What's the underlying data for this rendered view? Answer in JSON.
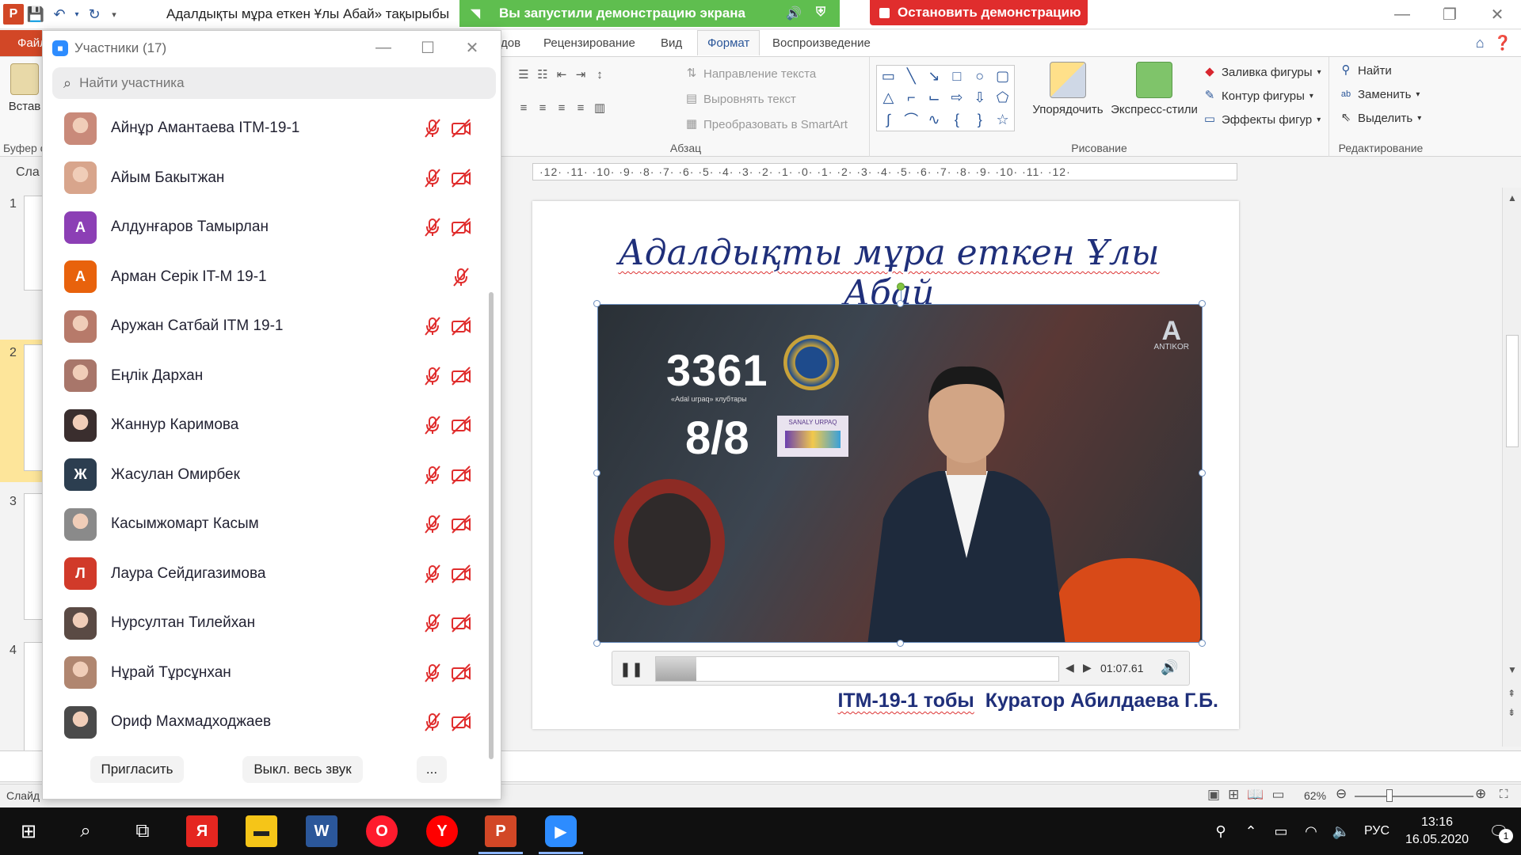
{
  "app": {
    "doc_title": "Адалдықты мұра еткен Ұлы Абай» тақырыбы",
    "logo_letter": "P"
  },
  "share_banner": {
    "message": "Вы запустили демонстрацию экрана",
    "stop_label": "Остановить демонстрацию"
  },
  "ribbon_tabs": {
    "file": "Файл",
    "items": [
      "дов",
      "Рецензирование",
      "Вид",
      "Формат",
      "Воспроизведение"
    ],
    "active": "Формат"
  },
  "ribbon": {
    "paste_label": "Встав",
    "clipboard_label": "Буфер о",
    "text_direction": "Направление текста",
    "align_text": "Выровнять текст",
    "smartart": "Преобразовать в SmartArt",
    "paragraph_label": "Абзац",
    "arrange": "Упорядочить",
    "quick_styles": "Экспресс-стили",
    "shape_fill": "Заливка фигуры",
    "shape_outline": "Контур фигуры",
    "shape_effects": "Эффекты фигур",
    "drawing_label": "Рисование",
    "find": "Найти",
    "replace": "Заменить",
    "select": "Выделить",
    "editing_label": "Редактирование",
    "accent_color": "#d24726"
  },
  "thumbs": {
    "header": "Сла",
    "numbers": [
      "1",
      "2",
      "3",
      "4"
    ]
  },
  "ruler": {
    "text": "·12·  ·11·  ·10·  ·9·  ·8·  ·7·  ·6·  ·5·  ·4·  ·3·  ·2·  ·1·  ·0·  ·1·  ·2·  ·3·  ·4·  ·5·  ·6·  ·7·  ·8·  ·9·  ·10·  ·11·  ·12·"
  },
  "slide": {
    "title": "Адалдықты мұра еткен Ұлы Абай",
    "video": {
      "overlay_number": "3361",
      "overlay_caption": "«Adal urpaq» клубтары",
      "overlay_score": "8/8",
      "brand": "ANTIKOR",
      "brand_letter": "A",
      "card_text": "SANALY URPAQ"
    },
    "player": {
      "time": "01:07.61",
      "progress": 0.1
    },
    "footer_group": "ITM-19-1 тобы",
    "footer_curator": "Куратор Абилдаева Г.Б."
  },
  "statusbar": {
    "slide_label": "Слайд",
    "zoom": "62%"
  },
  "participants": {
    "title": "Участники (17)",
    "search_placeholder": "Найти участника",
    "list": [
      {
        "name": "Айнұр Амантаева ITM-19-1",
        "avatar_letter": "",
        "avatar_color": "#c98a7a",
        "mic_muted": true,
        "video_off": true
      },
      {
        "name": "Айым Бакытжан",
        "avatar_letter": "",
        "avatar_color": "#d8a58c",
        "mic_muted": true,
        "video_off": true
      },
      {
        "name": "Алдунғаров Тамырлан",
        "avatar_letter": "А",
        "avatar_color": "#8c3fb5",
        "mic_muted": true,
        "video_off": true
      },
      {
        "name": "Арман Серік IT-M 19-1",
        "avatar_letter": "А",
        "avatar_color": "#e8620c",
        "mic_muted": true,
        "video_off": false
      },
      {
        "name": "Аружан Сатбай ITM 19-1",
        "avatar_letter": "",
        "avatar_color": "#b77a6a",
        "mic_muted": true,
        "video_off": true
      },
      {
        "name": "Еңлік Дархан",
        "avatar_letter": "",
        "avatar_color": "#a8766a",
        "mic_muted": true,
        "video_off": true
      },
      {
        "name": "Жаннур Каримова",
        "avatar_letter": "",
        "avatar_color": "#3a2e2e",
        "mic_muted": true,
        "video_off": true
      },
      {
        "name": "Жасулан Омирбек",
        "avatar_letter": "Ж",
        "avatar_color": "#2c3e50",
        "mic_muted": true,
        "video_off": true
      },
      {
        "name": "Касымжомарт Касым",
        "avatar_letter": "",
        "avatar_color": "#8a8a8a",
        "mic_muted": true,
        "video_off": true
      },
      {
        "name": "Лаура Сейдигазимова",
        "avatar_letter": "Л",
        "avatar_color": "#d13a2a",
        "mic_muted": true,
        "video_off": true
      },
      {
        "name": "Нурсултан Тилейхан",
        "avatar_letter": "",
        "avatar_color": "#5a4a44",
        "mic_muted": true,
        "video_off": true
      },
      {
        "name": "Нұрай Тұрсұнхан",
        "avatar_letter": "",
        "avatar_color": "#b08670",
        "mic_muted": true,
        "video_off": true
      },
      {
        "name": "Ориф Махмадходжаев",
        "avatar_letter": "",
        "avatar_color": "#4a4a4a",
        "mic_muted": true,
        "video_off": true
      }
    ],
    "invite_label": "Пригласить",
    "mute_all_label": "Выкл. весь звук",
    "more_label": "..."
  },
  "taskbar": {
    "apps": [
      "windows-start",
      "search",
      "task-view",
      "yandex-browser",
      "file-explorer",
      "word",
      "opera",
      "yandex",
      "powerpoint",
      "zoom"
    ],
    "lang": "РУС",
    "time": "13:16",
    "date": "16.05.2020",
    "notification_count": "1"
  },
  "colors": {
    "banner_green": "#5fbe4f",
    "stop_red": "#e02d2d",
    "mute_red": "#e02d2d",
    "title_blue": "#1f2f7a"
  }
}
